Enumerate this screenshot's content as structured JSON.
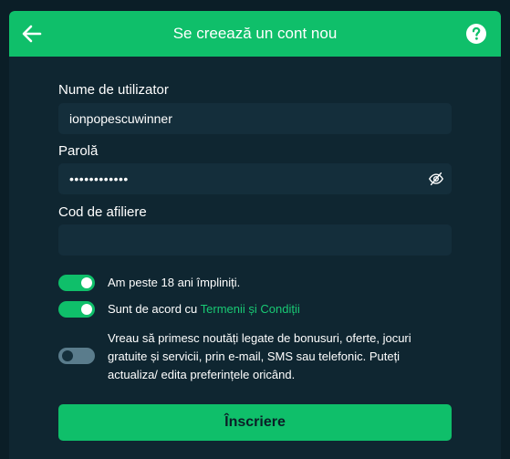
{
  "header": {
    "title": "Se creează un cont nou",
    "back_icon": "arrow-left-icon",
    "help_icon": "help-circle-icon"
  },
  "form": {
    "username": {
      "label": "Nume de utilizator",
      "value": "ionpopescuwinner"
    },
    "password": {
      "label": "Parolă",
      "value": "••••••••••••",
      "toggle_icon": "eye-off-icon"
    },
    "affiliate": {
      "label": "Cod de afiliere",
      "value": ""
    },
    "toggles": {
      "age": {
        "on": true,
        "text": "Am peste 18 ani împliniți."
      },
      "terms": {
        "on": true,
        "text_prefix": "Sunt de acord cu ",
        "link": "Termenii și Condiții"
      },
      "marketing": {
        "on": false,
        "text": "Vreau să primesc noutăți legate de bonusuri, oferte, jocuri gratuite și servicii, prin e-mail, SMS sau telefonic. Puteți actualiza/ edita preferințele oricând."
      }
    },
    "submit_label": "Înscriere"
  },
  "colors": {
    "accent": "#0fbf6a",
    "panel": "#0f2631",
    "input": "#142e3b",
    "toggle_off": "#5a7c8c"
  }
}
